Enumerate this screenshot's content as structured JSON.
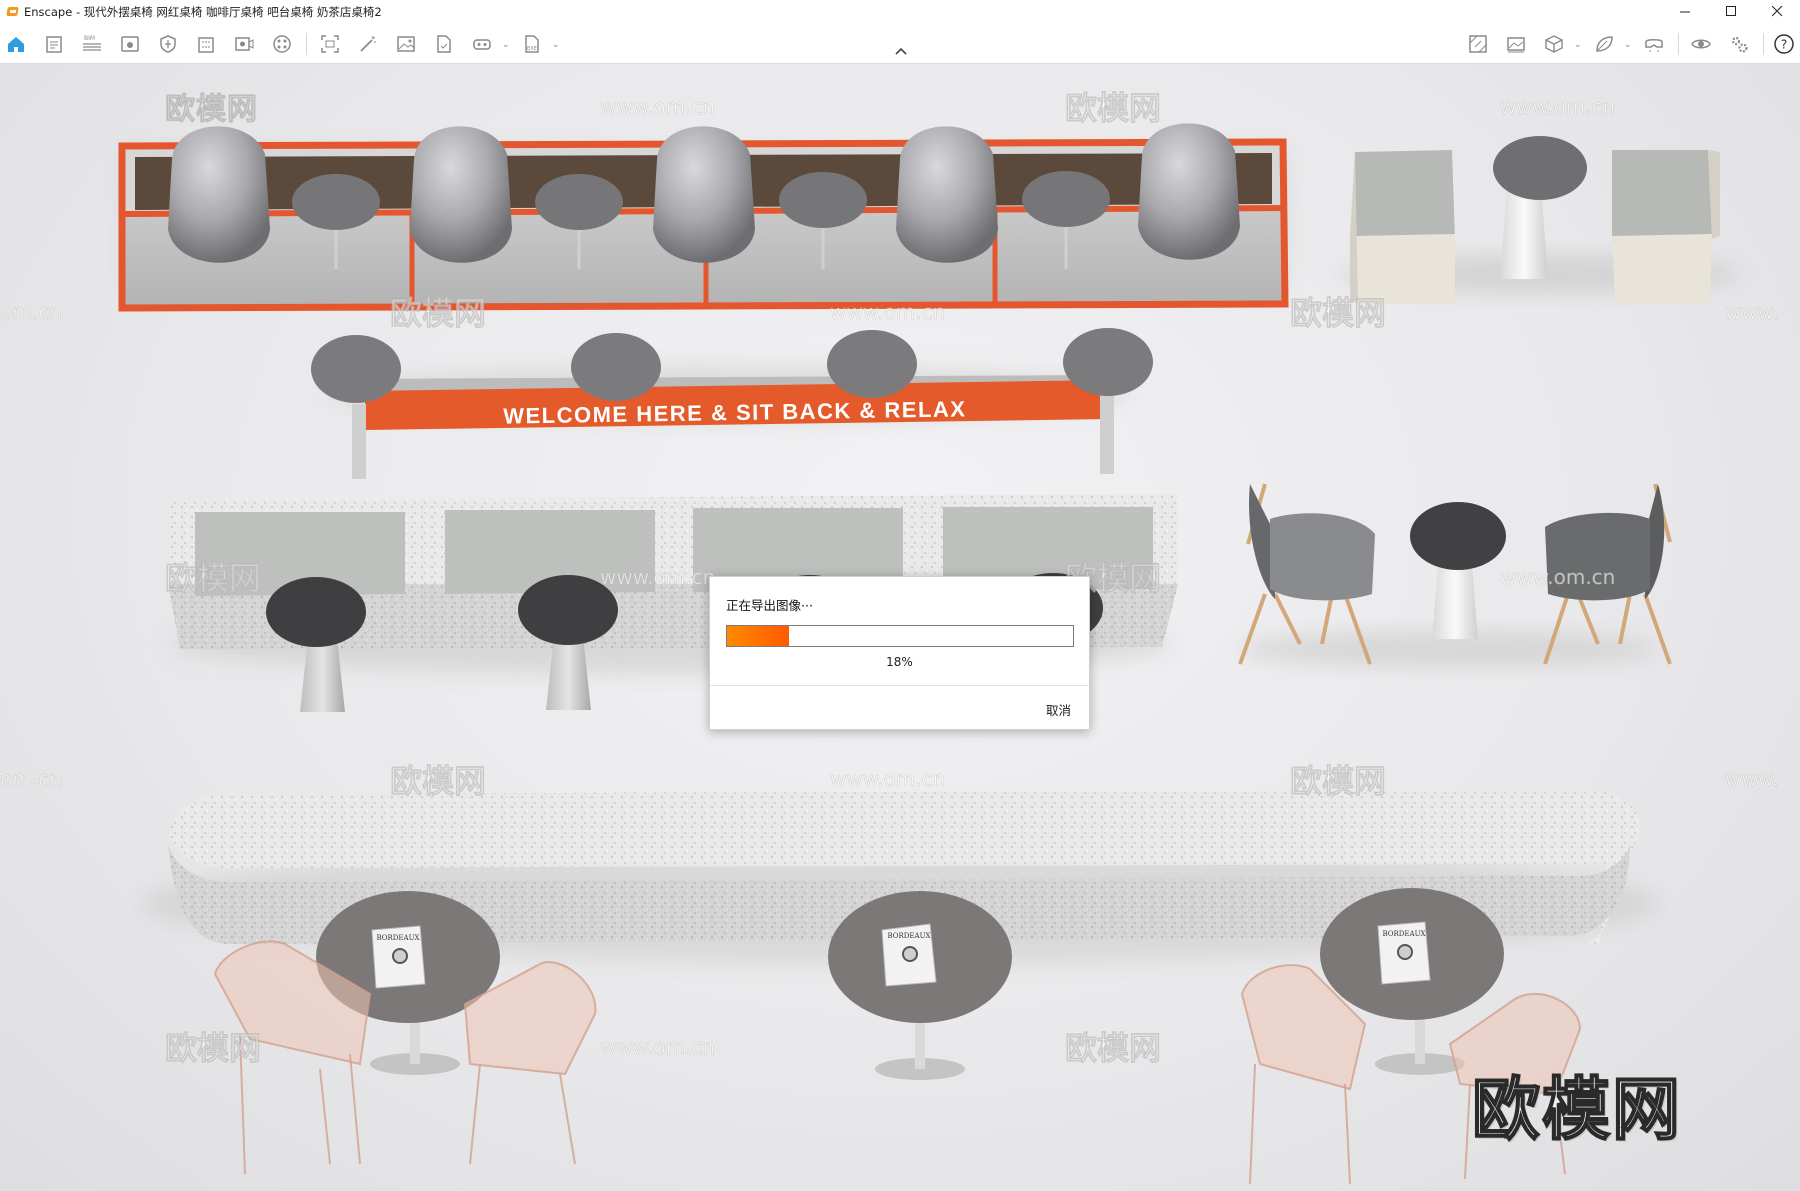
{
  "window": {
    "app_name": "Enscape",
    "title": "Enscape - 现代外摆桌椅 网红桌椅 咖啡厅桌椅 吧台桌椅 奶茶店桌椅2"
  },
  "toolbar": {
    "icons": [
      "home-icon",
      "document-icon",
      "bim-list-icon",
      "view-icon",
      "shield-icon",
      "building-icon",
      "video-camera-icon",
      "palette-icon",
      "image-frame-icon",
      "magic-wand-icon",
      "picture-icon",
      "file-check-icon",
      "vr-headset-icon",
      "export-icon",
      "map-icon",
      "panorama-icon",
      "cube-icon",
      "leaf-icon",
      "vr-glasses-icon",
      "eye-icon",
      "settings-icon",
      "help-icon"
    ],
    "bim_badge": "BIM",
    "exe_badge": "EXE",
    "help_glyph": "?"
  },
  "scene": {
    "bench_sign": "WELCOME HERE & SIT BACK & RELAX",
    "magazine_text": "BORDEAUX",
    "watermark_cn": "欧模网",
    "watermark_url": "www.om.cn",
    "watermark_url_partial_left": "om.cn",
    "watermark_url_partial_right": "www.",
    "brand_watermark": "欧模网"
  },
  "export_dialog": {
    "title": "正在导出图像···",
    "progress": 18,
    "progress_label": "18%",
    "cancel_label": "取消",
    "accent": "#ff7a00"
  }
}
